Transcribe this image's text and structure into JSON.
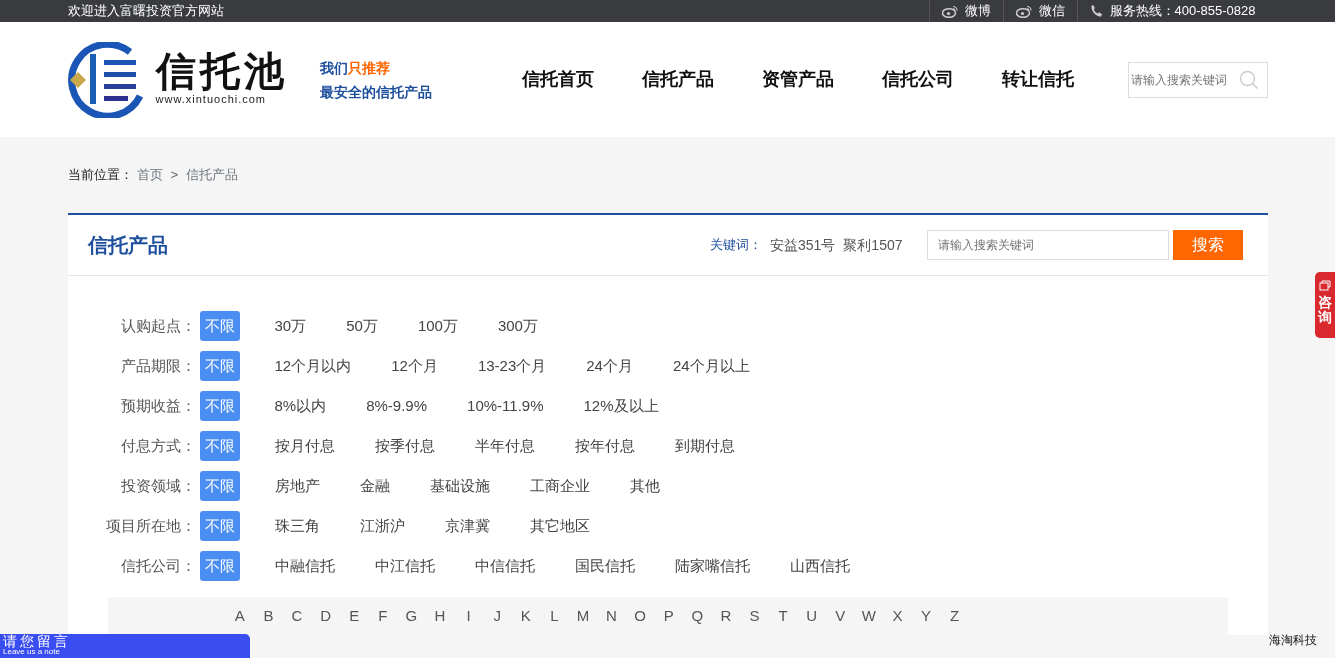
{
  "top_bar": {
    "welcome": "欢迎进入富曙投资官方网站",
    "links": [
      {
        "label": "微博",
        "kind": "weibo"
      },
      {
        "label": "微信",
        "kind": "weibo"
      },
      {
        "label": "服务热线：400-855-0828",
        "kind": "phone"
      }
    ]
  },
  "header": {
    "logo": {
      "name": "信托池",
      "url": "www.xintuochi.com"
    },
    "slogan": {
      "line1_a": "我们",
      "line1_b": "只推荐",
      "line2": "最安全的信托产品"
    },
    "nav": [
      {
        "label": "信托首页"
      },
      {
        "label": "信托产品"
      },
      {
        "label": "资管产品"
      },
      {
        "label": "信托公司"
      },
      {
        "label": "转让信托"
      }
    ],
    "search": {
      "placeholder": "请输入搜索关键词"
    }
  },
  "breadcrumb": {
    "label": "当前位置：",
    "items": [
      "首页",
      "信托产品"
    ],
    "separator": ">"
  },
  "panel": {
    "title": "信托产品",
    "keywords_label": "关键词：",
    "keywords": [
      "安益351号",
      "聚利1507"
    ],
    "search": {
      "placeholder": "请输入搜索关键词",
      "button": "搜索"
    },
    "filters": [
      {
        "label": "认购起点：",
        "options": [
          {
            "label": "不限",
            "selected": true
          },
          {
            "label": "30万",
            "selected": false
          },
          {
            "label": "50万",
            "selected": false
          },
          {
            "label": "100万",
            "selected": false
          },
          {
            "label": "300万",
            "selected": false
          }
        ]
      },
      {
        "label": "产品期限：",
        "options": [
          {
            "label": "不限",
            "selected": true
          },
          {
            "label": "12个月以内",
            "selected": false
          },
          {
            "label": "12个月",
            "selected": false
          },
          {
            "label": "13-23个月",
            "selected": false
          },
          {
            "label": "24个月",
            "selected": false
          },
          {
            "label": "24个月以上",
            "selected": false
          }
        ]
      },
      {
        "label": "预期收益：",
        "options": [
          {
            "label": "不限",
            "selected": true
          },
          {
            "label": "8%以内",
            "selected": false
          },
          {
            "label": "8%-9.9%",
            "selected": false
          },
          {
            "label": "10%-11.9%",
            "selected": false
          },
          {
            "label": "12%及以上",
            "selected": false
          }
        ]
      },
      {
        "label": "付息方式：",
        "options": [
          {
            "label": "不限",
            "selected": true
          },
          {
            "label": "按月付息",
            "selected": false
          },
          {
            "label": "按季付息",
            "selected": false
          },
          {
            "label": "半年付息",
            "selected": false
          },
          {
            "label": "按年付息",
            "selected": false
          },
          {
            "label": "到期付息",
            "selected": false
          }
        ]
      },
      {
        "label": "投资领域：",
        "options": [
          {
            "label": "不限",
            "selected": true
          },
          {
            "label": "房地产",
            "selected": false
          },
          {
            "label": "金融",
            "selected": false
          },
          {
            "label": "基础设施",
            "selected": false
          },
          {
            "label": "工商企业",
            "selected": false
          },
          {
            "label": "其他",
            "selected": false
          }
        ]
      },
      {
        "label": "项目所在地：",
        "options": [
          {
            "label": "不限",
            "selected": true
          },
          {
            "label": "珠三角",
            "selected": false
          },
          {
            "label": "江浙沪",
            "selected": false
          },
          {
            "label": "京津冀",
            "selected": false
          },
          {
            "label": "其它地区",
            "selected": false
          }
        ]
      },
      {
        "label": "信托公司：",
        "options": [
          {
            "label": "不限",
            "selected": true
          },
          {
            "label": "中融信托",
            "selected": false
          },
          {
            "label": "中江信托",
            "selected": false
          },
          {
            "label": "中信信托",
            "selected": false
          },
          {
            "label": "国民信托",
            "selected": false
          },
          {
            "label": "陆家嘴信托",
            "selected": false
          },
          {
            "label": "山西信托",
            "selected": false
          }
        ]
      }
    ],
    "letters": [
      "A",
      "B",
      "C",
      "D",
      "E",
      "F",
      "G",
      "H",
      "I",
      "J",
      "K",
      "L",
      "M",
      "N",
      "O",
      "P",
      "Q",
      "R",
      "S",
      "T",
      "U",
      "V",
      "W",
      "X",
      "Y",
      "Z"
    ]
  },
  "consult_tab": {
    "label": "咨询"
  },
  "message_bar": {
    "title": "请您留言",
    "subtitle": "Leave us a note"
  },
  "corner_text": "海淘科技"
}
